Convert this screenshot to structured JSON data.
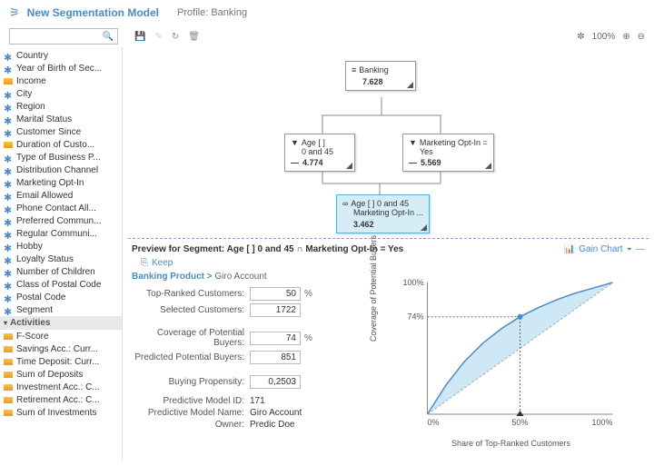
{
  "header": {
    "title": "New Segmentation Model",
    "profile_label": "Profile:",
    "profile_value": "Banking"
  },
  "zoom": {
    "pct": "100%"
  },
  "sidebar": {
    "items": [
      {
        "icon": "globe",
        "label": "Country"
      },
      {
        "icon": "globe",
        "label": "Year of Birth of Sec..."
      },
      {
        "icon": "bar",
        "label": "Income"
      },
      {
        "icon": "globe",
        "label": "City"
      },
      {
        "icon": "globe",
        "label": "Region"
      },
      {
        "icon": "globe",
        "label": "Marital Status"
      },
      {
        "icon": "globe",
        "label": "Customer Since"
      },
      {
        "icon": "bar",
        "label": "Duration of Custo..."
      },
      {
        "icon": "globe",
        "label": "Type of Business P..."
      },
      {
        "icon": "globe",
        "label": "Distribution Channel"
      },
      {
        "icon": "globe",
        "label": "Marketing Opt-In"
      },
      {
        "icon": "globe",
        "label": "Email Allowed"
      },
      {
        "icon": "globe",
        "label": "Phone Contact All..."
      },
      {
        "icon": "globe",
        "label": "Preferred Commun..."
      },
      {
        "icon": "globe",
        "label": "Regular Communi..."
      },
      {
        "icon": "globe",
        "label": "Hobby"
      },
      {
        "icon": "globe",
        "label": "Loyalty Status"
      },
      {
        "icon": "globe",
        "label": "Number of Children"
      },
      {
        "icon": "globe",
        "label": "Class of Postal Code"
      },
      {
        "icon": "globe",
        "label": "Postal Code"
      },
      {
        "icon": "globe",
        "label": "Segment"
      }
    ],
    "group": "Activities",
    "activities": [
      {
        "icon": "bar",
        "label": "F-Score"
      },
      {
        "icon": "bar",
        "label": "Savings Acc.: Curr..."
      },
      {
        "icon": "bar",
        "label": "Time Deposit: Curr..."
      },
      {
        "icon": "bar",
        "label": "Sum of Deposits"
      },
      {
        "icon": "bar",
        "label": "Investment Acc.: C..."
      },
      {
        "icon": "bar",
        "label": "Retirement Acc.: C..."
      },
      {
        "icon": "bar",
        "label": "Sum of Investments"
      }
    ]
  },
  "tree": {
    "root": {
      "title": "Banking",
      "value": "7.628"
    },
    "n1": {
      "title": "Age [ ]",
      "sub": "0 and 45",
      "value": "4.774"
    },
    "n2": {
      "title": "Marketing Opt-In =",
      "sub": "Yes",
      "value": "5.569"
    },
    "n3": {
      "title": "Age [ ] 0 and 45",
      "sub": "Marketing Opt-In ...",
      "value": "3.462"
    }
  },
  "preview": {
    "title": "Preview for Segment: Age [ ] 0 and 45 ∩ Marketing Opt-In = Yes",
    "gain_chart": "Gain Chart",
    "keep": "Keep",
    "crumb_main": "Banking Product >",
    "crumb_sub": "Giro Account",
    "fields": {
      "top_ranked_label": "Top-Ranked Customers:",
      "top_ranked": "50",
      "top_ranked_unit": "%",
      "selected_label": "Selected Customers:",
      "selected": "1722",
      "coverage_label": "Coverage of Potential Buyers:",
      "coverage": "74",
      "coverage_unit": "%",
      "predicted_label": "Predicted Potential Buyers:",
      "predicted": "851",
      "propensity_label": "Buying Propensity:",
      "propensity": "0,2503"
    },
    "meta": {
      "model_id_label": "Predictive Model ID:",
      "model_id": "171",
      "model_name_label": "Predictive Model Name:",
      "model_name": "Giro Account",
      "owner_label": "Owner:",
      "owner": "Predic Doe"
    }
  },
  "chart_data": {
    "type": "line",
    "title": "Gain Chart",
    "xlabel": "Share of Top-Ranked Customers",
    "ylabel": "Coverage of Potential Buyers",
    "xlim": [
      0,
      100
    ],
    "ylim": [
      0,
      100
    ],
    "x_ticks": [
      "0%",
      "50%",
      "100%"
    ],
    "y_ticks": [
      "0%",
      "74%",
      "100%"
    ],
    "series": [
      {
        "name": "gain",
        "x": [
          0,
          10,
          20,
          30,
          40,
          50,
          60,
          70,
          80,
          90,
          100
        ],
        "values": [
          0,
          22,
          40,
          54,
          65,
          74,
          81,
          87,
          92,
          96,
          100
        ]
      },
      {
        "name": "baseline",
        "x": [
          0,
          100
        ],
        "values": [
          0,
          100
        ]
      }
    ],
    "marker": {
      "x": 50,
      "y": 74
    }
  }
}
